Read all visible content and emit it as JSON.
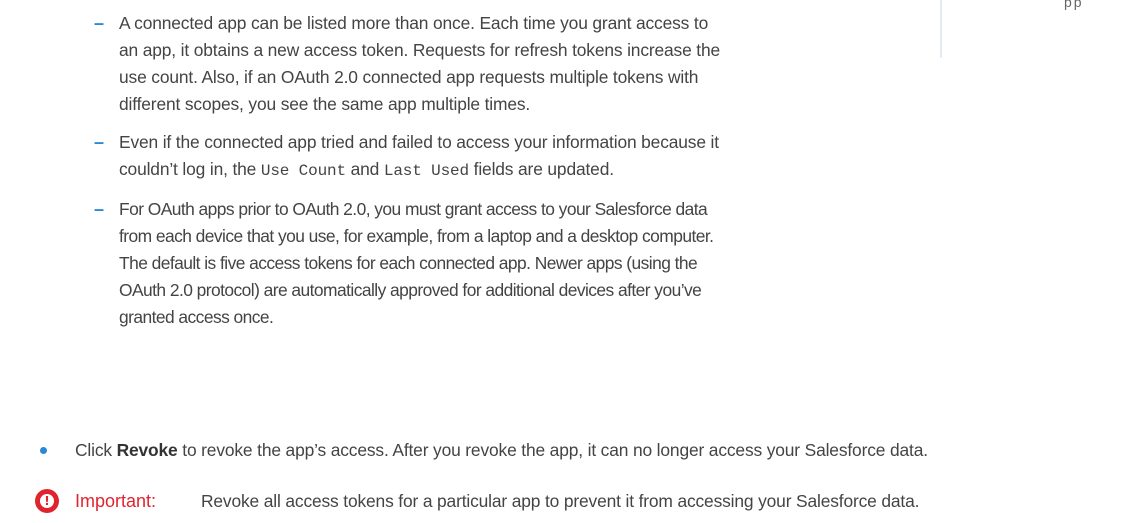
{
  "sidebar": {
    "glyph": "pp"
  },
  "sub_items": [
    {
      "lines": [
        "A connected app can be listed more than once. Each time you grant access to",
        "an app, it obtains a new access token. Requests for refresh tokens increase the",
        "use count. Also, if an OAuth 2.0 connected app requests multiple tokens with",
        "different scopes, you see the same app multiple times."
      ]
    },
    {
      "line1": "Even if the connected app tried and failed to access your information because it",
      "line2_before": "couldn’t log in, the ",
      "code1": "Use Count",
      "line2_mid": " and ",
      "code2": "Last Used",
      "line2_after": " fields are updated."
    },
    {
      "lines": [
        "For OAuth apps prior to OAuth 2.0, you must grant access to your Salesforce data",
        "from each device that you use, for example, from a laptop and a desktop computer.",
        "The default is five access tokens for each connected app. Newer apps (using the",
        "OAuth 2.0 protocol) are automatically approved for additional devices after you’ve",
        "granted access once."
      ]
    }
  ],
  "bullet": {
    "prefix": "Click ",
    "bold": "Revoke",
    "suffix": " to revoke the app’s access. After you revoke the app, it can no longer access your Salesforce data."
  },
  "important": {
    "label": "Important:",
    "text": "Revoke all access tokens for a particular app to prevent it from accessing your Salesforce data.",
    "icon_color": "#e0242f"
  },
  "colors": {
    "accent": "#2a89d4",
    "text": "#444444",
    "warning": "#e0242f"
  }
}
